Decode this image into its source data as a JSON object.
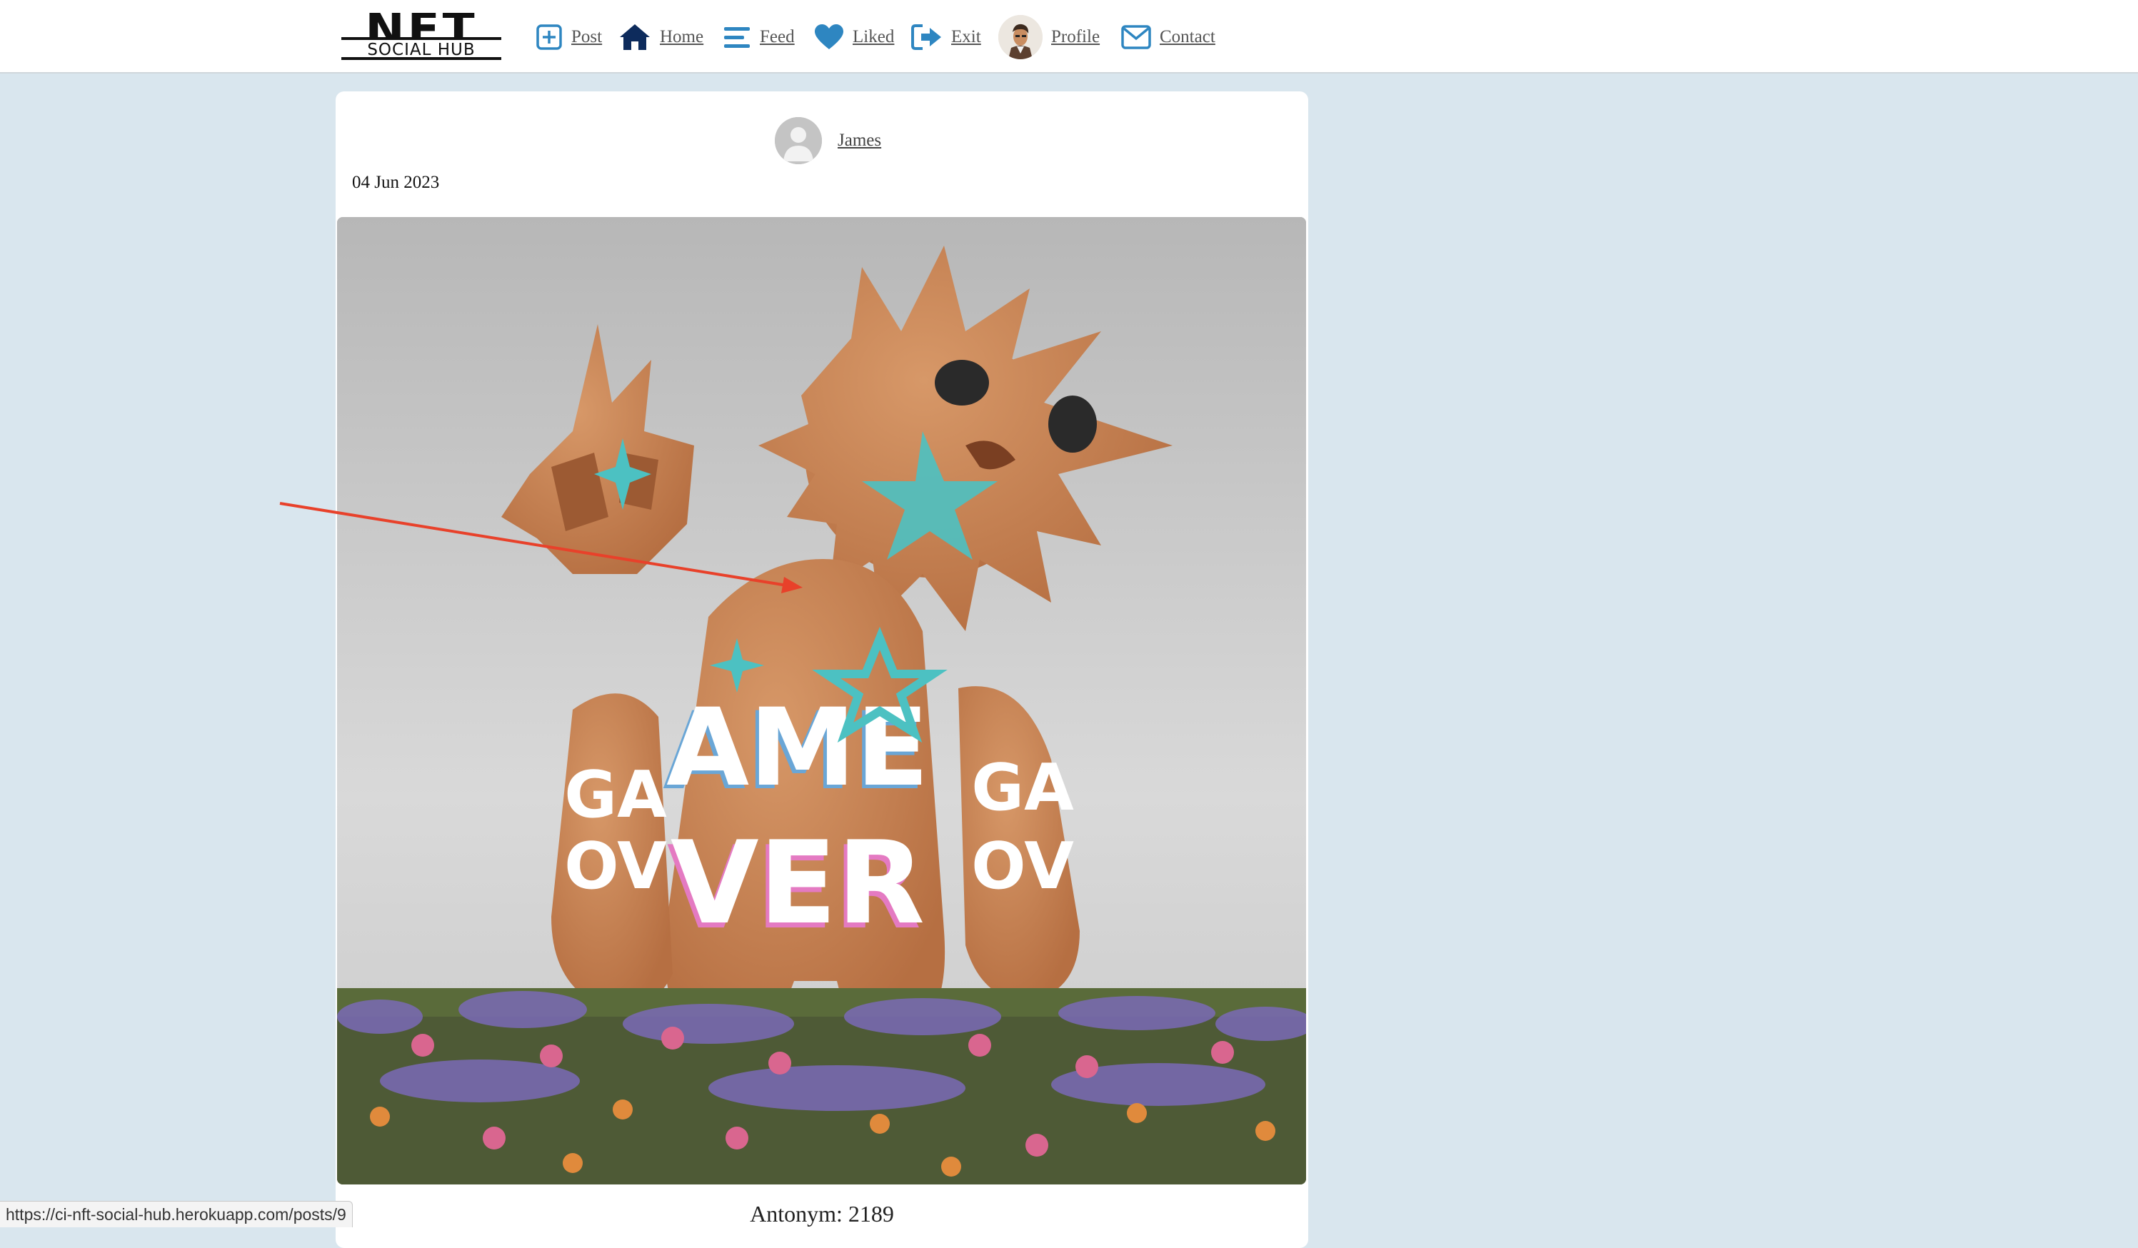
{
  "nav": {
    "logo_top": "NFT",
    "logo_bottom": "SOCIAL HUB",
    "items": [
      {
        "label": "Post",
        "icon": "plus-square-icon"
      },
      {
        "label": "Home",
        "icon": "home-icon"
      },
      {
        "label": "Feed",
        "icon": "bars-icon"
      },
      {
        "label": "Liked",
        "icon": "heart-icon"
      },
      {
        "label": "Exit",
        "icon": "sign-out-icon"
      },
      {
        "label": "Profile",
        "icon": "profile-avatar"
      },
      {
        "label": "Contact",
        "icon": "envelope-icon"
      }
    ]
  },
  "post": {
    "owner": "James",
    "date": "04 Jun 2023",
    "title": "Antonym: 2189",
    "image_alt": "3D figure with spiky heads in a flower field, 'GAME OVER' print"
  },
  "status_bar": {
    "url": "https://ci-nft-social-hub.herokuapp.com/posts/9"
  },
  "colors": {
    "page_bg": "#d9e6ee",
    "icon_blue": "#2e86c1",
    "icon_navy": "#0d2b5c",
    "annotation_red": "#e8412a"
  }
}
